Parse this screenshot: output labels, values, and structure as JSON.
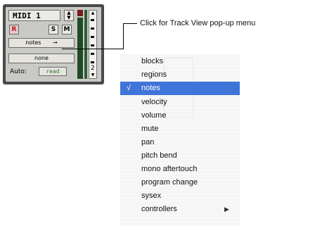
{
  "track": {
    "name": "MIDI 1",
    "rec_label": "R",
    "solo_label": "S",
    "mute_label": "M",
    "view_value": "notes",
    "view_arrow": "→",
    "submenu_value": "none",
    "auto_label": "Auto:",
    "auto_value": "read",
    "ruler_number": "2"
  },
  "callout": {
    "text": "Click for Track View pop-up menu"
  },
  "menu": {
    "items": [
      {
        "label": "blocks"
      },
      {
        "label": "regions"
      },
      {
        "label": "notes",
        "checked": "√"
      },
      {
        "label": "velocity"
      },
      {
        "label": "volume"
      },
      {
        "label": "mute"
      },
      {
        "label": "pan"
      },
      {
        "label": "pitch bend"
      },
      {
        "label": "mono aftertouch"
      },
      {
        "label": "program change"
      },
      {
        "label": "sysex"
      },
      {
        "label": "controllers",
        "submenu_arrow": "▶"
      }
    ]
  },
  "colors": {
    "selection": "#3f74d8",
    "meter": "#1f4a28",
    "meter_clip": "#7a1a1a"
  }
}
